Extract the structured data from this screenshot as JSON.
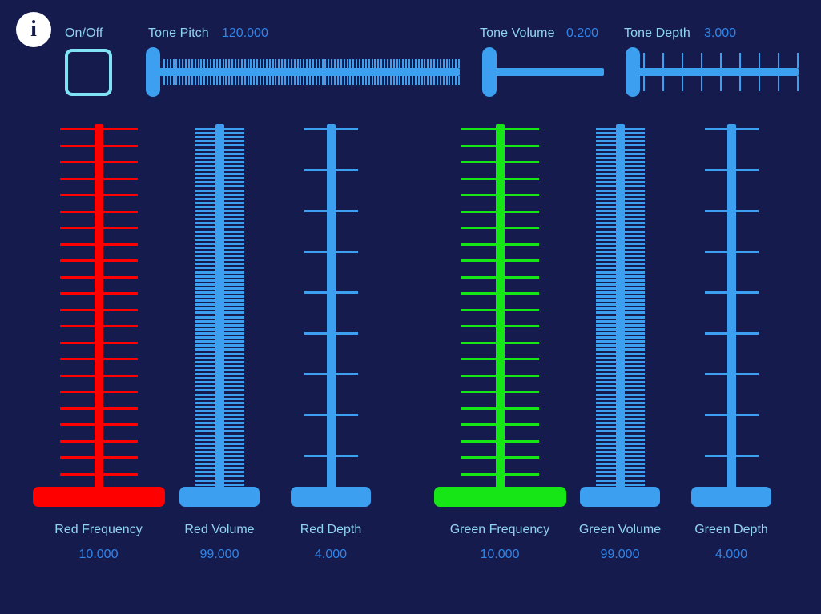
{
  "theme": {
    "background": "#161b4e",
    "blue": "#3c9ff0",
    "red": "#ff0000",
    "green": "#16e616",
    "label_color": "#8fd4f0",
    "value_color": "#2f85e8",
    "checkbox_border": "#7fe3f5",
    "info_bg": "#ffffff"
  },
  "header": {
    "info_icon": "info-icon",
    "info_glyph": "i",
    "onoff": {
      "label": "On/Off",
      "checked": false
    },
    "controls": [
      {
        "name": "tone-pitch",
        "label": "Tone Pitch",
        "value": "120.000",
        "value_number": 120.0,
        "fill_ratio": 0.0,
        "tick_count": 96,
        "tick_style": "dense"
      },
      {
        "name": "tone-volume",
        "label": "Tone Volume",
        "value": "0.200",
        "value_number": 0.2,
        "fill_ratio": 0.0,
        "tick_count": 0,
        "tick_style": "none"
      },
      {
        "name": "tone-depth",
        "label": "Tone Depth",
        "value": "3.000",
        "value_number": 3.0,
        "fill_ratio": 0.0,
        "tick_count": 9,
        "tick_style": "sparse"
      }
    ]
  },
  "sliders": [
    {
      "name": "red-frequency",
      "label": "Red Frequency",
      "value": "10.000",
      "value_number": 10.0,
      "color": "#ff0000",
      "tick_count": 23,
      "tick_spacing": 20.5,
      "tick_half_width": 43,
      "thumb_width": 165,
      "position_ratio": 0.0
    },
    {
      "name": "red-volume",
      "label": "Red Volume",
      "value": "99.000",
      "value_number": 99.0,
      "color": "#3c9ff0",
      "tick_count": 91,
      "tick_spacing": 5.1,
      "tick_half_width": 25,
      "thumb_width": 100,
      "position_ratio": 0.0
    },
    {
      "name": "red-depth",
      "label": "Red Depth",
      "value": "4.000",
      "value_number": 4.0,
      "color": "#3c9ff0",
      "tick_count": 10,
      "tick_spacing": 51.0,
      "tick_half_width": 28,
      "thumb_width": 100,
      "position_ratio": 0.0
    },
    {
      "name": "green-frequency",
      "label": "Green Frequency",
      "value": "10.000",
      "value_number": 10.0,
      "color": "#16e616",
      "tick_count": 23,
      "tick_spacing": 20.5,
      "tick_half_width": 43,
      "thumb_width": 165,
      "position_ratio": 0.0
    },
    {
      "name": "green-volume",
      "label": "Green Volume",
      "value": "99.000",
      "value_number": 99.0,
      "color": "#3c9ff0",
      "tick_count": 91,
      "tick_spacing": 5.1,
      "tick_half_width": 25,
      "thumb_width": 100,
      "position_ratio": 0.0
    },
    {
      "name": "green-depth",
      "label": "Green Depth",
      "value": "4.000",
      "value_number": 4.0,
      "color": "#3c9ff0",
      "tick_count": 10,
      "tick_spacing": 51.0,
      "tick_half_width": 28,
      "thumb_width": 100,
      "position_ratio": 0.0
    }
  ]
}
